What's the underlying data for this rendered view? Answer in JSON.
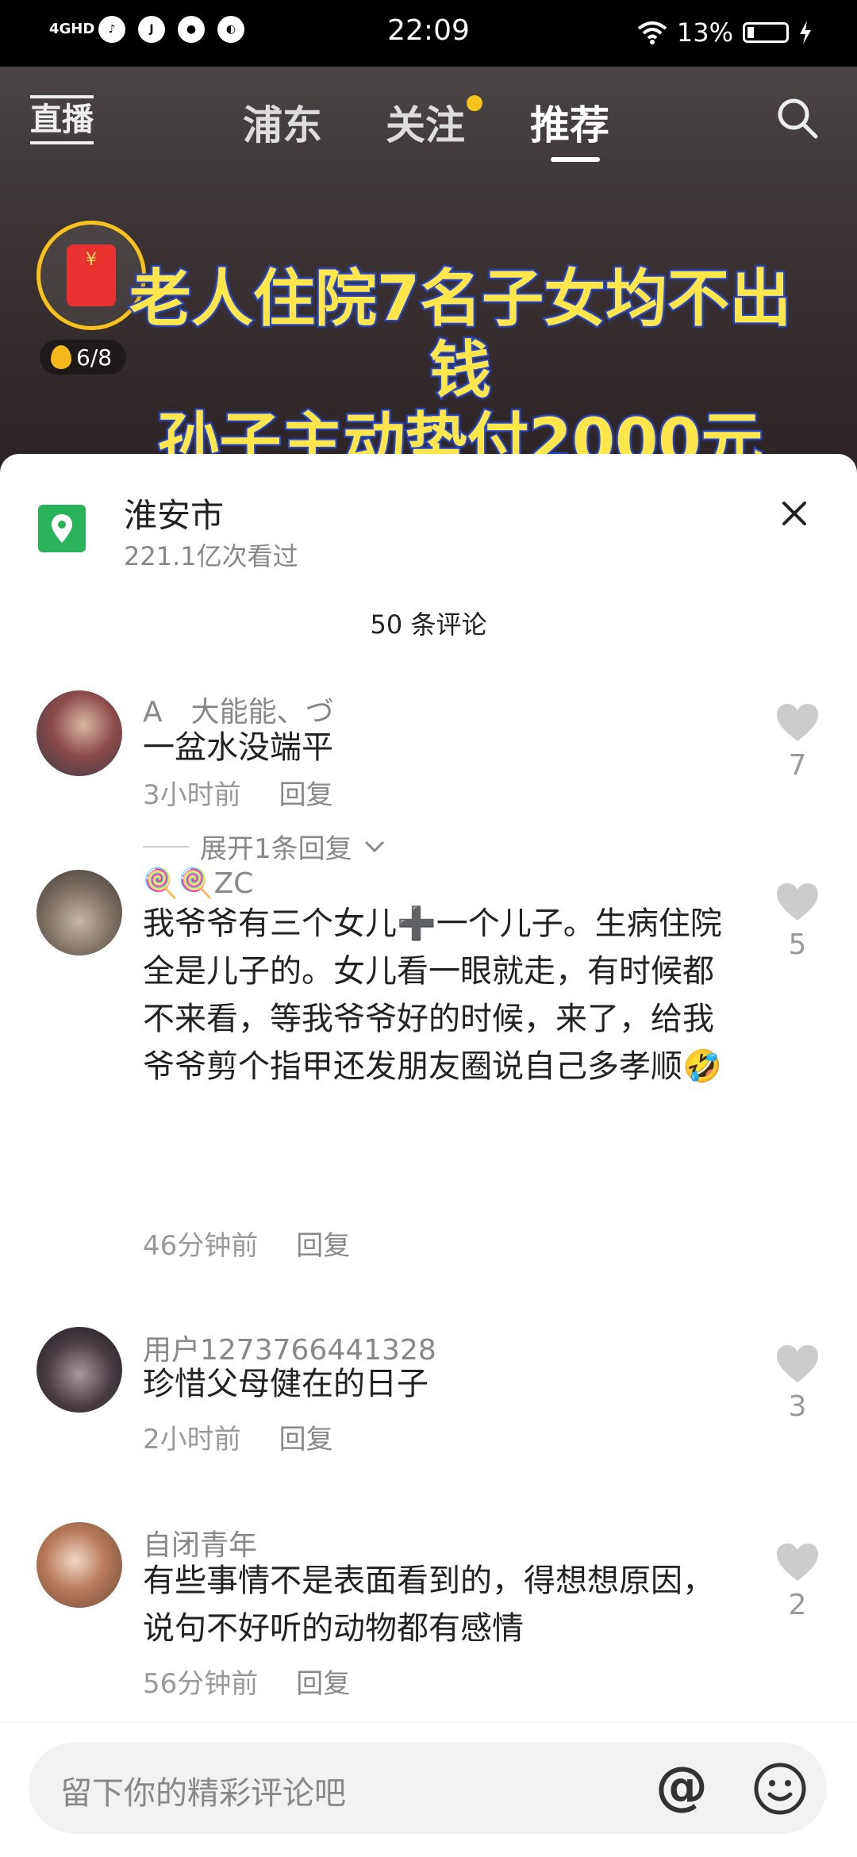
{
  "status_bar": {
    "network": "4GHD",
    "time": "22:09",
    "battery": "13%"
  },
  "top_nav": {
    "live_label": "直播",
    "tabs": [
      {
        "label": "浦东"
      },
      {
        "label": "关注"
      },
      {
        "label": "推荐"
      }
    ],
    "active_tab": "推荐"
  },
  "video": {
    "headline_line1": "老人住院7名子女均不出钱",
    "headline_line2": "孙子主动垫付2000元",
    "red_packet_symbol": "¥",
    "egg_progress": "6/8"
  },
  "location": {
    "name": "淮安市",
    "views": "221.1亿次看过"
  },
  "comments_header": "50 条评论",
  "comments": [
    {
      "user": "A　大能能、づ",
      "text": "一盆水没端平",
      "time": "3小时前",
      "reply_label": "回复",
      "likes": "7",
      "expand": "展开1条回复"
    },
    {
      "user": "🍭🍭ZC",
      "text": "我爷爷有三个女儿➕一个儿子。生病住院全是儿子的。女儿看一眼就走，有时候都不来看，等我爷爷好的时候，来了，给我爷爷剪个指甲还发朋友圈说自己多孝顺🤣",
      "time": "46分钟前",
      "reply_label": "回复",
      "likes": "5"
    },
    {
      "user": "用户1273766441328",
      "text": "珍惜父母健在的日子",
      "time": "2小时前",
      "reply_label": "回复",
      "likes": "3"
    },
    {
      "user": "自闭青年",
      "text": "有些事情不是表面看到的，得想想原因，说句不好听的动物都有感情",
      "time": "56分钟前",
      "reply_label": "回复",
      "likes": "2"
    }
  ],
  "input": {
    "placeholder": "留下你的精彩评论吧",
    "at_symbol": "@"
  }
}
